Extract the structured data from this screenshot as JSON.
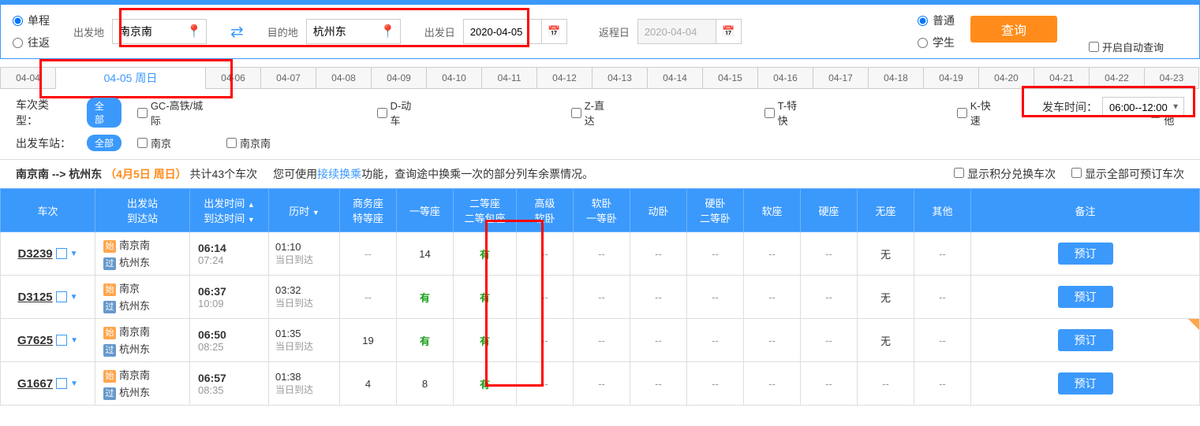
{
  "trip_type": {
    "single": "单程",
    "round": "往返"
  },
  "search": {
    "from_label": "出发地",
    "from": "南京南",
    "to_label": "目的地",
    "to": "杭州东",
    "depart_label": "出发日",
    "depart_date": "2020-04-05",
    "return_label": "返程日",
    "return_date": "2020-04-04"
  },
  "passenger": {
    "normal": "普通",
    "student": "学生"
  },
  "search_btn": "查询",
  "auto_query": "开启自动查询",
  "date_tabs": [
    "04-04",
    "04-05 周日",
    "04-06",
    "04-07",
    "04-08",
    "04-09",
    "04-10",
    "04-11",
    "04-12",
    "04-13",
    "04-14",
    "04-15",
    "04-16",
    "04-17",
    "04-18",
    "04-19",
    "04-20",
    "04-21",
    "04-22",
    "04-23"
  ],
  "active_tab_index": 1,
  "filter_train_type": {
    "label": "车次类型：",
    "all": "全部",
    "options": [
      "GC-高铁/城际",
      "D-动车",
      "Z-直达",
      "T-特快",
      "K-快速",
      "其他"
    ]
  },
  "filter_station": {
    "label": "出发车站：",
    "all": "全部",
    "options": [
      "南京",
      "南京南"
    ]
  },
  "depart_time": {
    "label": "发车时间：",
    "value": "06:00--12:00"
  },
  "summary": {
    "route": "南京南 --> 杭州东",
    "date": "（4月5日  周日）",
    "total": "共计43个车次",
    "tip_before": "您可使用",
    "tip_link": "接续换乘",
    "tip_after": "功能，查询途中换乘一次的部分列车余票情况。",
    "show_points": "显示积分兑换车次",
    "show_all": "显示全部可预订车次"
  },
  "headers": {
    "train_no": "车次",
    "station_dep": "出发站",
    "station_arr": "到达站",
    "time_dep": "出发时间",
    "time_arr": "到达时间",
    "duration": "历时",
    "business": "商务座",
    "special": "特等座",
    "first": "一等座",
    "second": "二等座",
    "second_box": "二等包座",
    "soft_high": "高级",
    "soft_sleeper": "软卧",
    "soft1": "软卧",
    "first_sleeper": "一等卧",
    "move_sleeper": "动卧",
    "hard_sleeper": "硬卧",
    "second_sleeper": "二等卧",
    "soft_seat": "软座",
    "hard_seat": "硬座",
    "no_seat": "无座",
    "other": "其他",
    "remark": "备注"
  },
  "badges": {
    "start": "始",
    "pass": "过"
  },
  "same_day": "当日到达",
  "book": "预订",
  "trains": [
    {
      "no": "D3239",
      "from": "南京南",
      "to": "杭州东",
      "from_badge": "start",
      "to_badge": "pass",
      "dep": "06:14",
      "arr": "07:24",
      "dur": "01:10",
      "seats": {
        "business": "--",
        "first": "14",
        "second": "有",
        "soft_high": "--",
        "soft1": "--",
        "move": "--",
        "hard_sleeper": "--",
        "soft_seat": "--",
        "hard_seat": "--",
        "no_seat": "无",
        "other": "--"
      },
      "corner": false
    },
    {
      "no": "D3125",
      "from": "南京",
      "to": "杭州东",
      "from_badge": "start",
      "to_badge": "pass",
      "dep": "06:37",
      "arr": "10:09",
      "dur": "03:32",
      "seats": {
        "business": "--",
        "first": "有",
        "second": "有",
        "soft_high": "--",
        "soft1": "--",
        "move": "--",
        "hard_sleeper": "--",
        "soft_seat": "--",
        "hard_seat": "--",
        "no_seat": "无",
        "other": "--"
      },
      "corner": false
    },
    {
      "no": "G7625",
      "from": "南京南",
      "to": "杭州东",
      "from_badge": "start",
      "to_badge": "pass",
      "dep": "06:50",
      "arr": "08:25",
      "dur": "01:35",
      "seats": {
        "business": "19",
        "first": "有",
        "second": "有",
        "soft_high": "--",
        "soft1": "--",
        "move": "--",
        "hard_sleeper": "--",
        "soft_seat": "--",
        "hard_seat": "--",
        "no_seat": "无",
        "other": "--"
      },
      "corner": true
    },
    {
      "no": "G1667",
      "from": "南京南",
      "to": "杭州东",
      "from_badge": "start",
      "to_badge": "pass",
      "dep": "06:57",
      "arr": "08:35",
      "dur": "01:38",
      "seats": {
        "business": "4",
        "first": "8",
        "second": "有",
        "soft_high": "--",
        "soft1": "--",
        "move": "--",
        "hard_sleeper": "--",
        "soft_seat": "--",
        "hard_seat": "--",
        "no_seat": "--",
        "other": "--"
      },
      "corner": false
    }
  ]
}
